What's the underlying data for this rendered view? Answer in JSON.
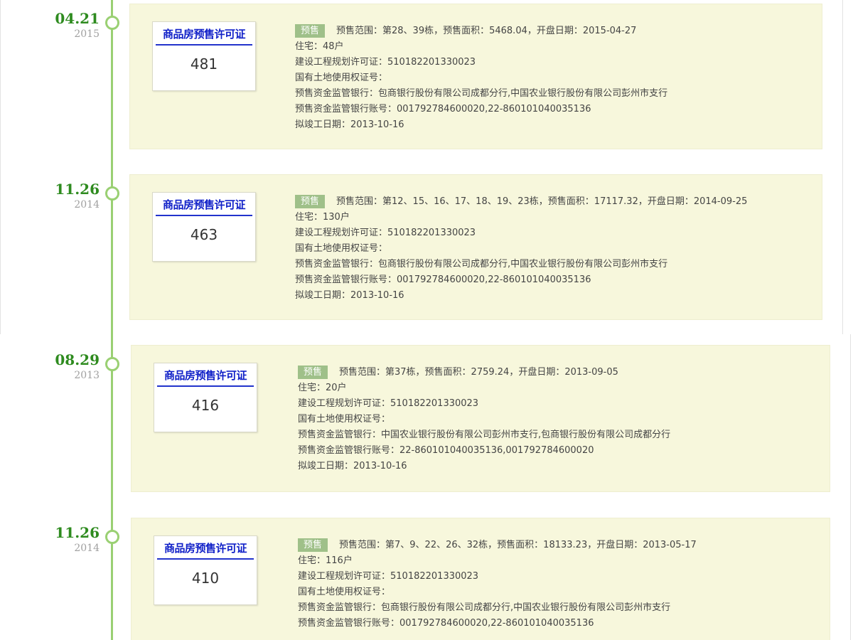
{
  "timeline": {
    "entries": [
      {
        "day": "04.21",
        "year": "2015",
        "permit_title": "商品房预售许可证",
        "permit_number": "481",
        "badge": "预售",
        "summary": "预售范围：第28、39栋，预售面积：5468.04，开盘日期：2015-04-27",
        "details": [
          "住宅：48户",
          "建设工程规划许可证：510182201330023",
          "国有土地使用权证号：",
          "预售资金监管银行：包商银行股份有限公司成都分行,中国农业银行股份有限公司彭州市支行",
          "预售资金监管银行账号：001792784600020,22-860101040035136",
          "拟竣工日期：2013-10-16"
        ]
      },
      {
        "day": "11.26",
        "year": "2014",
        "permit_title": "商品房预售许可证",
        "permit_number": "463",
        "badge": "预售",
        "summary": "预售范围：第12、15、16、17、18、19、23栋，预售面积：17117.32，开盘日期：2014-09-25",
        "details": [
          "住宅：130户",
          "建设工程规划许可证：510182201330023",
          "国有土地使用权证号：",
          "预售资金监管银行：包商银行股份有限公司成都分行,中国农业银行股份有限公司彭州市支行",
          "预售资金监管银行账号：001792784600020,22-860101040035136",
          "拟竣工日期：2013-10-16"
        ]
      },
      {
        "day": "08.29",
        "year": "2013",
        "permit_title": "商品房预售许可证",
        "permit_number": "416",
        "badge": "预售",
        "summary": "预售范围：第37栋，预售面积：2759.24，开盘日期：2013-09-05",
        "details": [
          "住宅：20户",
          "建设工程规划许可证：510182201330023",
          "国有土地使用权证号：",
          "预售资金监管银行：中国农业银行股份有限公司彭州市支行,包商银行股份有限公司成都分行",
          "预售资金监管银行账号：22-860101040035136,001792784600020",
          "拟竣工日期：2013-10-16"
        ]
      },
      {
        "day": "11.26",
        "year": "2014",
        "permit_title": "商品房预售许可证",
        "permit_number": "410",
        "badge": "预售",
        "summary": "预售范围：第7、9、22、26、32栋，预售面积：18133.23，开盘日期：2013-05-17",
        "details": [
          "住宅：116户",
          "建设工程规划许可证：510182201330023",
          "国有土地使用权证号：",
          "预售资金监管银行：包商银行股份有限公司成都分行,中国农业银行股份有限公司彭州市支行",
          "预售资金监管银行账号：001792784600020,22-860101040035136"
        ]
      }
    ]
  },
  "colors": {
    "timeline_green": "#9ad073",
    "date_green": "#2e8b1f",
    "card_bg": "#f7f7dc",
    "badge_bg": "#9fc089",
    "permit_title_blue": "#1020c8"
  }
}
